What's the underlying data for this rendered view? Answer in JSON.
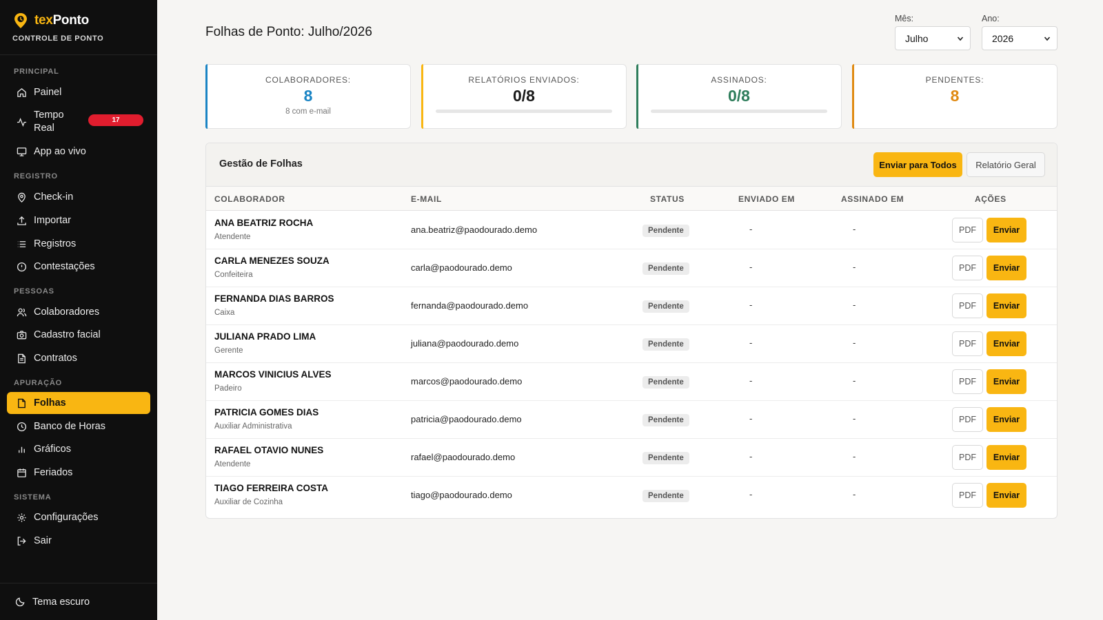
{
  "brand": {
    "name_prefix": "tex",
    "name_suffix": "Ponto",
    "subtitle": "CONTROLE DE PONTO",
    "logo_icon": "map-pin-clock-icon"
  },
  "sidebar": {
    "sections": [
      "PRINCIPAL",
      "REGISTRO",
      "PESSOAS",
      "APURAÇÃO",
      "SISTEMA"
    ],
    "items": [
      {
        "label": "Painel",
        "icon": "home-icon"
      },
      {
        "label": "Tempo Real",
        "icon": "activity-icon",
        "badge": "17"
      },
      {
        "label": "App ao vivo",
        "icon": "monitor-icon"
      },
      {
        "label": "Check-in",
        "icon": "map-pin-icon"
      },
      {
        "label": "Importar",
        "icon": "upload-icon"
      },
      {
        "label": "Registros",
        "icon": "list-icon"
      },
      {
        "label": "Contestações",
        "icon": "alert-circle-icon"
      },
      {
        "label": "Colaboradores",
        "icon": "users-icon"
      },
      {
        "label": "Cadastro facial",
        "icon": "camera-icon"
      },
      {
        "label": "Contratos",
        "icon": "file-text-icon"
      },
      {
        "label": "Folhas",
        "icon": "file-icon",
        "active": true
      },
      {
        "label": "Banco de Horas",
        "icon": "clock-icon"
      },
      {
        "label": "Gráficos",
        "icon": "bar-chart-icon"
      },
      {
        "label": "Feriados",
        "icon": "calendar-icon"
      },
      {
        "label": "Configurações",
        "icon": "gear-icon"
      },
      {
        "label": "Sair",
        "icon": "logout-icon"
      }
    ],
    "footer": {
      "label": "Tema escuro",
      "icon": "moon-icon"
    }
  },
  "header": {
    "title": "Folhas de Ponto: Julho/2026",
    "month_label": "Mês:",
    "month_value": "Julho",
    "year_label": "Ano:",
    "year_value": "2026"
  },
  "stats": [
    {
      "label": "COLABORADORES:",
      "value": "8",
      "note": "8 com e-mail",
      "color": "#1a84c4"
    },
    {
      "label": "RELATÓRIOS ENVIADOS:",
      "value": "0/8",
      "progress": 0,
      "color": "#f9b612"
    },
    {
      "label": "ASSINADOS:",
      "value": "0/8",
      "progress": 0,
      "color": "#2e7d5b"
    },
    {
      "label": "PENDENTES:",
      "value": "8",
      "color": "#e08a12"
    }
  ],
  "panel": {
    "title": "Gestão de Folhas",
    "send_all_label": "Enviar para Todos",
    "report_label": "Relatório Geral",
    "columns": [
      "COLABORADOR",
      "E-MAIL",
      "STATUS",
      "ENVIADO EM",
      "ASSINADO EM",
      "AÇÕES"
    ],
    "pdf_label": "PDF",
    "send_label": "Enviar",
    "rows": [
      {
        "name": "ANA BEATRIZ ROCHA",
        "role": "Atendente",
        "email": "ana.beatriz@paodourado.demo",
        "status": "Pendente",
        "sent": "-",
        "signed": "-"
      },
      {
        "name": "CARLA MENEZES SOUZA",
        "role": "Confeiteira",
        "email": "carla@paodourado.demo",
        "status": "Pendente",
        "sent": "-",
        "signed": "-"
      },
      {
        "name": "FERNANDA DIAS BARROS",
        "role": "Caixa",
        "email": "fernanda@paodourado.demo",
        "status": "Pendente",
        "sent": "-",
        "signed": "-"
      },
      {
        "name": "JULIANA PRADO LIMA",
        "role": "Gerente",
        "email": "juliana@paodourado.demo",
        "status": "Pendente",
        "sent": "-",
        "signed": "-"
      },
      {
        "name": "MARCOS VINICIUS ALVES",
        "role": "Padeiro",
        "email": "marcos@paodourado.demo",
        "status": "Pendente",
        "sent": "-",
        "signed": "-"
      },
      {
        "name": "PATRICIA GOMES DIAS",
        "role": "Auxiliar Administrativa",
        "email": "patricia@paodourado.demo",
        "status": "Pendente",
        "sent": "-",
        "signed": "-"
      },
      {
        "name": "RAFAEL OTAVIO NUNES",
        "role": "Atendente",
        "email": "rafael@paodourado.demo",
        "status": "Pendente",
        "sent": "-",
        "signed": "-"
      },
      {
        "name": "TIAGO FERREIRA COSTA",
        "role": "Auxiliar de Cozinha",
        "email": "tiago@paodourado.demo",
        "status": "Pendente",
        "sent": "-",
        "signed": "-"
      }
    ]
  }
}
